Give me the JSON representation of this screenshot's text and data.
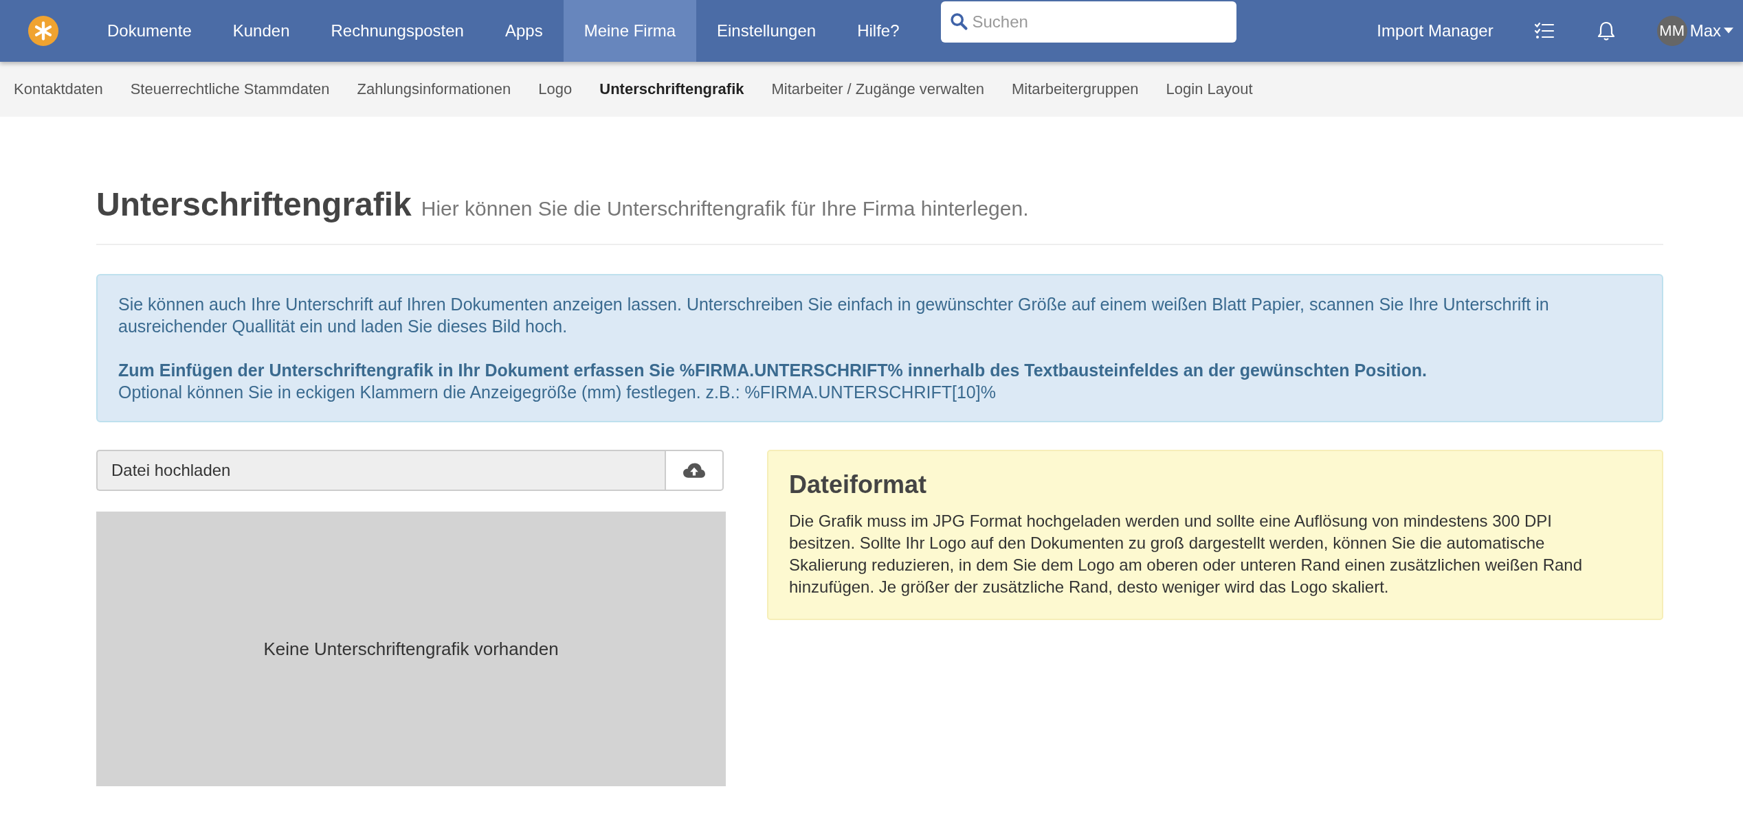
{
  "topbar": {
    "nav": [
      {
        "label": "Dokumente",
        "selected": false
      },
      {
        "label": "Kunden",
        "selected": false
      },
      {
        "label": "Rechnungsposten",
        "selected": false
      },
      {
        "label": "Apps",
        "selected": false
      },
      {
        "label": "Meine Firma",
        "selected": true
      },
      {
        "label": "Einstellungen",
        "selected": false
      },
      {
        "label": "Hilfe?",
        "selected": false
      }
    ],
    "search": {
      "placeholder": "Suchen"
    },
    "import_manager": "Import Manager",
    "user": {
      "initials": "MM",
      "name": "Max"
    }
  },
  "subnav": [
    {
      "label": "Kontaktdaten",
      "selected": false
    },
    {
      "label": "Steuerrechtliche Stammdaten",
      "selected": false
    },
    {
      "label": "Zahlungsinformationen",
      "selected": false
    },
    {
      "label": "Logo",
      "selected": false
    },
    {
      "label": "Unterschriftengrafik",
      "selected": true
    },
    {
      "label": "Mitarbeiter / Zugänge verwalten",
      "selected": false
    },
    {
      "label": "Mitarbeitergruppen",
      "selected": false
    },
    {
      "label": "Login Layout",
      "selected": false
    }
  ],
  "page": {
    "title": "Unterschriftengrafik",
    "subtitle": "Hier können Sie die Unterschriftengrafik für Ihre Firma hinterlegen."
  },
  "info": {
    "intro": "Sie können auch Ihre Unterschrift auf Ihren Dokumenten anzeigen lassen. Unterschreiben Sie einfach in gewünschter Größe auf einem weißen Blatt Papier, scannen Sie Ihre Unterschrift in ausreichender Quallität ein und laden Sie dieses Bild hoch.",
    "instruction": "Zum Einfügen der Unterschriftengrafik in Ihr Dokument erfassen Sie %FIRMA.UNTERSCHRIFT% innerhalb des Textbausteinfeldes an der gewünschten Position.",
    "optional": "Optional können Sie in eckigen Klammern die Anzeigegröße (mm) festlegen. z.B.: %FIRMA.UNTERSCHRIFT[10]%"
  },
  "upload": {
    "placeholder": "Datei hochladen"
  },
  "preview": {
    "empty_text": "Keine Unterschriftengrafik vorhanden"
  },
  "file_format": {
    "title": "Dateiformat",
    "text": "Die Grafik muss im JPG Format hochgeladen werden und sollte eine Auflösung von mindestens 300 DPI besitzen. Sollte Ihr Logo auf den Dokumenten zu groß dargestellt werden, können Sie die automatische Skalierung reduzieren, in dem Sie dem Logo am oberen oder unteren Rand einen zusätzlichen weißen Rand hinzufügen. Je größer der zusätzliche Rand, desto weniger wird das Logo skaliert."
  }
}
